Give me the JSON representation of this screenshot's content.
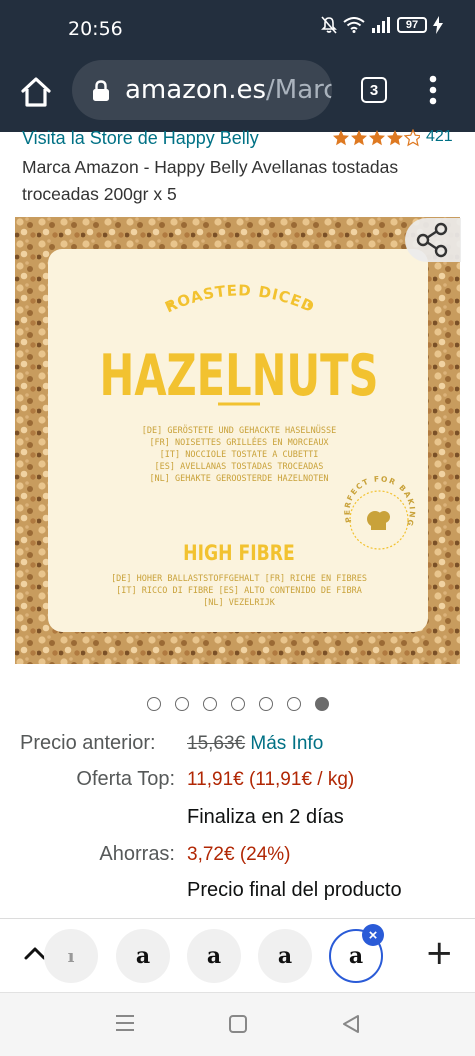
{
  "status_bar": {
    "time": "20:56",
    "battery": "97"
  },
  "browser": {
    "url_domain": "amazon.es",
    "url_rest": "/Marca",
    "tab_count": "3"
  },
  "product": {
    "store_link": "Visita la Store de Happy Belly",
    "rating": 4.5,
    "rating_count": "421",
    "title": "Marca Amazon - Happy Belly Avellanas tostadas troceadas 200gr x 5"
  },
  "package": {
    "tagline": "ROASTED DICED",
    "name": "HAZELNUTS",
    "translations": [
      "[DE] GERÖSTETE UND GEHACKTE HASELNÜSSE",
      "[FR] NOISETTES GRILLÉES EN MORCEAUX",
      "[IT] NOCCIOLE TOSTATE A CUBETTI",
      "[ES] AVELLANAS TOSTADAS TROCEADAS",
      "[NL] GEHAKTE GEROOSTERDE HAZELNOTEN"
    ],
    "badge_text": "PERFECT FOR BAKING",
    "fibre_heading": "HIGH FIBRE",
    "fibre_lines": [
      "[DE] HOHER BALLASTSTOFFGEHALT [FR] RICHE EN FIBRES",
      "[IT] RICCO DI FIBRE [ES] ALTO CONTENIDO DE FIBRA",
      "[NL] VEZELRIJK"
    ]
  },
  "carousel": {
    "total": 7,
    "active_index": 6
  },
  "pricing": {
    "previous_label": "Precio anterior:",
    "previous_value": "15,63€",
    "more_info": "Más Info",
    "deal_label": "Oferta Top:",
    "deal_value": "11,91€ (11,91€ / kg)",
    "ends": "Finaliza en 2 días",
    "savings_label": "Ahorras:",
    "savings_value": "3,72€ (24%)",
    "final_price_note": "Precio final del producto"
  },
  "tab_strip": {
    "tabs": [
      {
        "glyph": "ı",
        "name": "tab-partial"
      },
      {
        "glyph": "a",
        "name": "tab-amazon-1"
      },
      {
        "glyph": "a",
        "name": "tab-amazon-2"
      },
      {
        "glyph": "a",
        "name": "tab-amazon-3"
      },
      {
        "glyph": "a",
        "name": "tab-amazon-active"
      }
    ],
    "close_glyph": "×",
    "new_tab_glyph": "+"
  },
  "colors": {
    "header_bg": "#232f3e",
    "link": "#007185",
    "deal_red": "#b12704",
    "star": "#de7921",
    "package_yellow": "#f2c230",
    "package_bg": "#fbf3dd",
    "active_tab": "#2a5bd7"
  },
  "icons": {
    "home": "home-icon",
    "lock": "lock-icon",
    "menu": "more-vert-icon",
    "share": "share-icon",
    "chevron_up": "chevron-up-icon",
    "nav_menu": "recents-icon",
    "nav_home": "square-home-icon",
    "nav_back": "back-triangle-icon"
  }
}
